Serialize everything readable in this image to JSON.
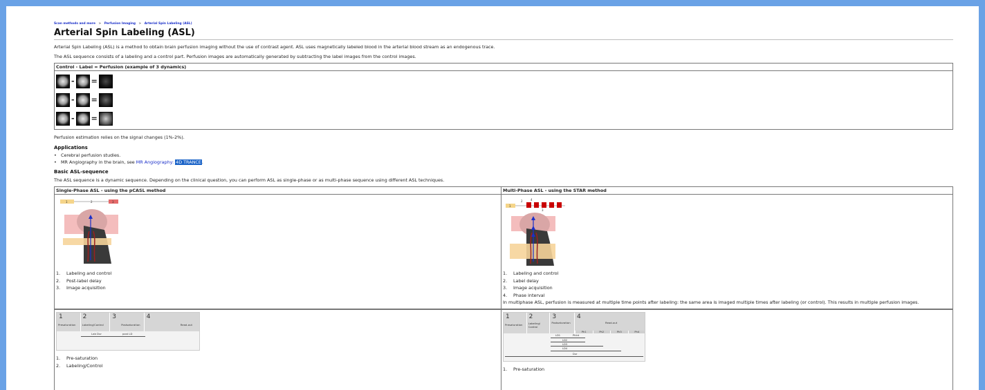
{
  "breadcrumb": {
    "items": [
      "Scan methods and more",
      "Perfusion Imaging",
      "Arterial Spin Labeling (ASL)"
    ],
    "separator": ">"
  },
  "page": {
    "title": "Arterial Spin Labeling (ASL)",
    "intro1": "Arterial Spin Labeling (ASL) is a method to obtain brain perfusion imaging without the use of contrast agent. ASL uses magnetically labeled blood in the arterial blood stream as an endogenous trace.",
    "intro2": "The ASL sequence consists of a labeling and a control part. Perfusion images are automatically generated by subtracting the label images from the control images."
  },
  "control_table": {
    "header": "Control - Label = Perfusion (example of 3 dynamics)",
    "minus": "-",
    "equals": "="
  },
  "perfusion_note": "Perfusion estimation relies on the signal changes (1%-2%).",
  "applications": {
    "heading": "Applications",
    "item1": "Cerebral perfusion studies.",
    "item2_prefix": "MR Angiography in the brain, see ",
    "item2_link": "MR Angiography:",
    "item2_tag1": "4D",
    "item2_tag2": "TRANCE",
    "item2_suffix": "."
  },
  "basic": {
    "heading": "Basic ASL-sequence",
    "text": "The ASL sequence is a dynamic sequence. Depending on the clinical question, you can perform ASL as single-phase or as multi-phase sequence using different ASL techniques."
  },
  "methods": {
    "single_header": "Single-Phase ASL - using the pCASL method",
    "multi_header": "Multi-Phase ASL - using the STAR method",
    "single_steps": [
      "Labeling and control",
      "Post-label delay",
      "Image acquisition"
    ],
    "multi_steps": [
      "Labeling and control",
      "Label delay",
      "Image acquisition",
      "Phase interval"
    ],
    "multi_note": "In multiphase ASL, perfusion is measured at multiple time points after labeling: the same area is imaged multiple times after labeling (or control). This results in multiple perfusion images.",
    "single_diagram_nums": [
      "1",
      "2",
      "3"
    ],
    "multi_diagram_nums": [
      "1",
      "2",
      "3",
      "4"
    ]
  },
  "timing": {
    "single_segments": [
      "Presaturation",
      "Labeling/Control",
      "Postsaturation",
      "Read-out"
    ],
    "single_nums": [
      "1",
      "2",
      "3",
      "4"
    ],
    "single_labels": [
      "Lab Dur",
      "post LD"
    ],
    "single_steps": [
      "Pre-saturation",
      "Labeling/Control"
    ],
    "multi_segments": [
      "Presaturation",
      "Labeling/ Control",
      "Postsaturation",
      "Read-out"
    ],
    "multi_nums": [
      "1",
      "2",
      "3",
      "4"
    ],
    "multi_phases": [
      "Ph1",
      "Ph2",
      "Ph3",
      "Ph4"
    ],
    "multi_labels": [
      "LD1",
      "PhInt",
      "LD2",
      "LD3",
      "LD4",
      "Dur"
    ],
    "multi_steps": [
      "Pre-saturation"
    ]
  },
  "colors": {
    "window_border": "#6aa2e6",
    "link": "#1a2fc9",
    "highlight": "#1c64c8"
  }
}
